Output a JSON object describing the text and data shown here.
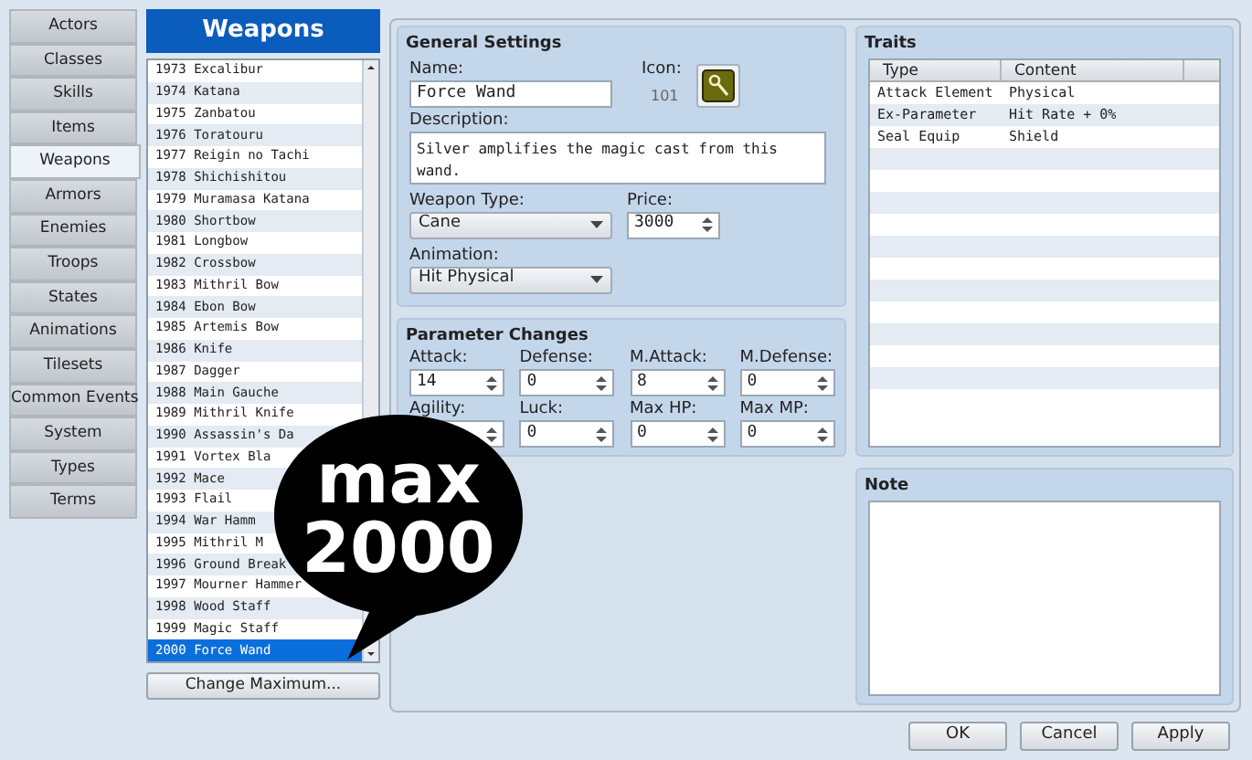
{
  "nav": [
    {
      "label": "Actors",
      "selected": false
    },
    {
      "label": "Classes",
      "selected": false
    },
    {
      "label": "Skills",
      "selected": false
    },
    {
      "label": "Items",
      "selected": false
    },
    {
      "label": "Weapons",
      "selected": true
    },
    {
      "label": "Armors",
      "selected": false
    },
    {
      "label": "Enemies",
      "selected": false
    },
    {
      "label": "Troops",
      "selected": false
    },
    {
      "label": "States",
      "selected": false
    },
    {
      "label": "Animations",
      "selected": false
    },
    {
      "label": "Tilesets",
      "selected": false
    },
    {
      "label": "Common Events",
      "selected": false
    },
    {
      "label": "System",
      "selected": false
    },
    {
      "label": "Types",
      "selected": false
    },
    {
      "label": "Terms",
      "selected": false
    }
  ],
  "list": {
    "title": "Weapons",
    "items": [
      {
        "text": "1973 Excalibur",
        "selected": false
      },
      {
        "text": "1974 Katana",
        "selected": false
      },
      {
        "text": "1975 Zanbatou",
        "selected": false
      },
      {
        "text": "1976 Toratouru",
        "selected": false
      },
      {
        "text": "1977 Reigin no Tachi",
        "selected": false
      },
      {
        "text": "1978 Shichishitou",
        "selected": false
      },
      {
        "text": "1979 Muramasa Katana",
        "selected": false
      },
      {
        "text": "1980 Shortbow",
        "selected": false
      },
      {
        "text": "1981 Longbow",
        "selected": false
      },
      {
        "text": "1982 Crossbow",
        "selected": false
      },
      {
        "text": "1983 Mithril Bow",
        "selected": false
      },
      {
        "text": "1984 Ebon Bow",
        "selected": false
      },
      {
        "text": "1985 Artemis Bow",
        "selected": false
      },
      {
        "text": "1986 Knife",
        "selected": false
      },
      {
        "text": "1987 Dagger",
        "selected": false
      },
      {
        "text": "1988 Main Gauche",
        "selected": false
      },
      {
        "text": "1989 Mithril Knife",
        "selected": false
      },
      {
        "text": "1990 Assassin's Da",
        "selected": false
      },
      {
        "text": "1991 Vortex Bla",
        "selected": false
      },
      {
        "text": "1992 Mace",
        "selected": false
      },
      {
        "text": "1993 Flail",
        "selected": false
      },
      {
        "text": "1994 War Hamm",
        "selected": false
      },
      {
        "text": "1995 Mithril M",
        "selected": false
      },
      {
        "text": "1996 Ground Break",
        "selected": false
      },
      {
        "text": "1997 Mourner Hammer",
        "selected": false
      },
      {
        "text": "1998 Wood Staff",
        "selected": false
      },
      {
        "text": "1999 Magic Staff",
        "selected": false
      },
      {
        "text": "2000 Force Wand",
        "selected": true
      }
    ],
    "button": "Change Maximum..."
  },
  "general": {
    "title": "General Settings",
    "name_label": "Name:",
    "name": "Force Wand",
    "icon_label": "Icon:",
    "icon_index": "101",
    "description_label": "Description:",
    "description": "Silver amplifies the magic cast from this wand.",
    "weapon_type_label": "Weapon Type:",
    "weapon_type": "Cane",
    "price_label": "Price:",
    "price": "3000",
    "animation_label": "Animation:",
    "animation": "Hit Physical"
  },
  "parameters": {
    "title": "Parameter Changes",
    "fields": [
      {
        "label": "Attack:",
        "value": "14"
      },
      {
        "label": "Defense:",
        "value": "0"
      },
      {
        "label": "M.Attack:",
        "value": "8"
      },
      {
        "label": "M.Defense:",
        "value": "0"
      },
      {
        "label": "Agility:"
      },
      {
        "label": "Luck:",
        "value": "0"
      },
      {
        "label": "Max HP:",
        "value": "0"
      },
      {
        "label": "Max MP:",
        "value": "0"
      }
    ]
  },
  "traits": {
    "title": "Traits",
    "columns": [
      "Type",
      "Content"
    ],
    "rows": [
      [
        "Attack Element",
        "Physical"
      ],
      [
        "Ex-Parameter",
        "Hit Rate + 0%"
      ],
      [
        "Seal Equip",
        "Shield"
      ]
    ]
  },
  "note": {
    "title": "Note"
  },
  "buttons": [
    "OK",
    "Cancel",
    "Apply"
  ],
  "callout": {
    "lines": [
      "max",
      "2000"
    ]
  }
}
